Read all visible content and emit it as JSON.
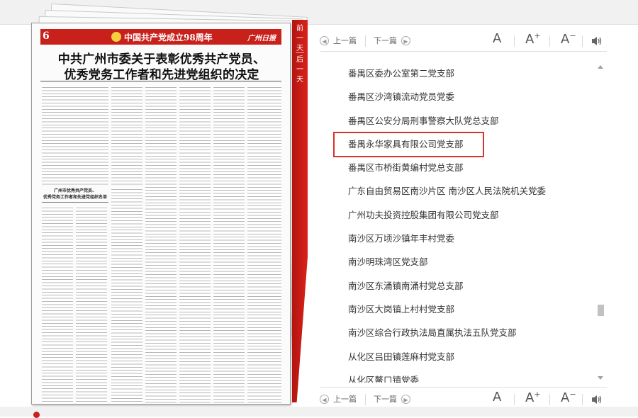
{
  "newspaper": {
    "page_number": "6",
    "masthead_title": "中国共产党成立98周年",
    "masthead_logo": "广州日报",
    "headline_line1": "中共广州市委关于表彰优秀共产党员、",
    "headline_line2": "优秀党务工作者和先进党组织的决定",
    "subhead_line1": "广州市优秀共产党员、",
    "subhead_line2": "优秀党务工作者和先进党组织名单"
  },
  "date_nav": {
    "prev_day": "前一天",
    "next_day": "后一天"
  },
  "toolbar": {
    "prev_label": "上一篇",
    "next_label": "下一篇",
    "font_default": "A",
    "font_increase": "A",
    "font_increase_sup": "+",
    "font_decrease": "A",
    "font_decrease_sup": "−",
    "speaker_icon": "speaker-icon"
  },
  "org_list": [
    "番禺区委办公室第二党支部",
    "番禺区沙湾镇流动党员党委",
    "番禺区公安分局刑事警察大队党总支部",
    "番禺永华家具有限公司党支部",
    "番禺区市桥街黄编村党总支部",
    "广东自由贸易区南沙片区 南沙区人民法院机关党委",
    "广州功夫投资控股集团有限公司党支部",
    "南沙区万顷沙镇年丰村党委",
    "南沙明珠湾区党支部",
    "南沙区东涌镇南涌村党总支部",
    "南沙区大岗镇上村村党支部",
    "南沙区综合行政执法局直属执法五队党支部",
    "从化区吕田镇莲麻村党支部",
    "从化区鳌口镇党委"
  ],
  "highlighted_item": "番禺永华家具有限公司党支部",
  "colors": {
    "accent_red": "#c8201b",
    "highlight_border": "#d9312b"
  }
}
